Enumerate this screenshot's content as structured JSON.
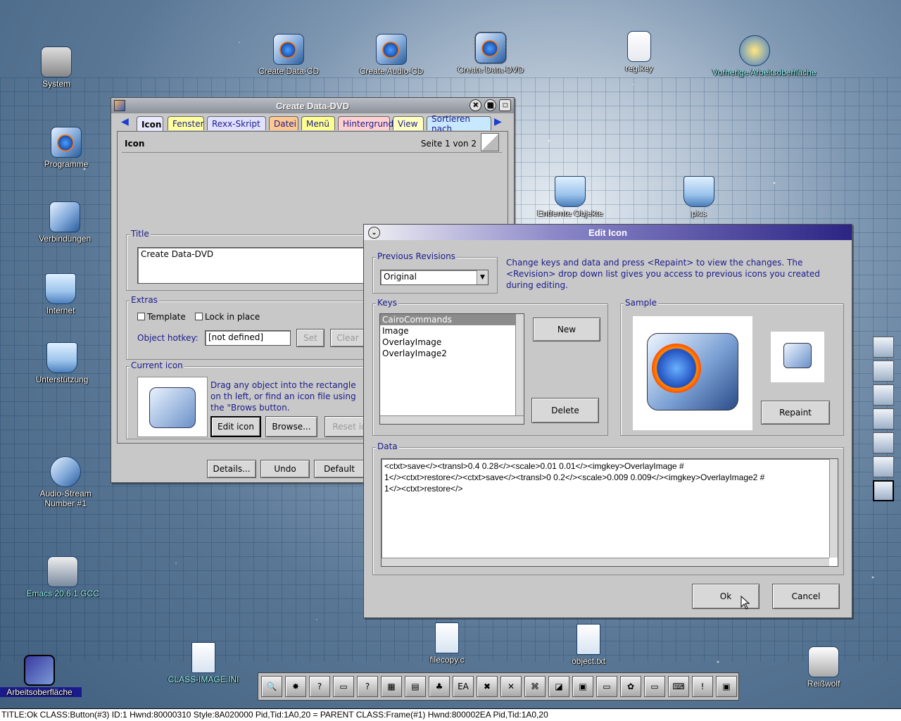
{
  "desktop": {
    "icons": [
      {
        "label": "System"
      },
      {
        "label": "Programme"
      },
      {
        "label": "Verbindungen"
      },
      {
        "label": "Internet"
      },
      {
        "label": "Unterstützung"
      },
      {
        "label": "Audio-Stream Number #1"
      },
      {
        "label": "Emacs 20.6.1 GCC"
      },
      {
        "label": "Create Data-CD"
      },
      {
        "label": "Create Audio-CD"
      },
      {
        "label": "Create Data-DVD"
      },
      {
        "label": "reg.key"
      },
      {
        "label": "Vorherige Arbeitsoberfläche"
      },
      {
        "label": "Entfernte Objekte"
      },
      {
        "label": "pics"
      },
      {
        "label": "filecopy.c"
      },
      {
        "label": "object.txt"
      },
      {
        "label": "CLASS-IMAGE.INI"
      },
      {
        "label": "Reißwolf"
      },
      {
        "label": "Arbeitsoberfläche"
      }
    ]
  },
  "settings_window": {
    "title": "Create Data-DVD",
    "tabs": [
      "Icon",
      "Fenster",
      "Rexx-Skript",
      "Datei",
      "Menü",
      "Hintergrund",
      "View",
      "Sortieren nach"
    ],
    "tab_colors": [
      "#e8e8ff",
      "#ffffa0",
      "#e0e0ff",
      "#ffc890",
      "#ffff90",
      "#ffd0d0",
      "#ffffc0",
      "#c8e8ff"
    ],
    "page_heading": "Icon",
    "page_indicator": "Seite 1 von 2",
    "title_group": "Title",
    "title_value": "Create Data-DVD",
    "extras_group": "Extras",
    "template_label": "Template",
    "lock_label": "Lock in place",
    "hotkey_label": "Object hotkey:",
    "hotkey_value": "[not defined]",
    "set_btn": "Set",
    "clear_btn": "Clear",
    "current_icon_group": "Current icon",
    "current_icon_help": "Drag any object into the rectangle on th left, or find an icon file using the \"Brows button.",
    "edit_icon_btn": "Edit icon",
    "browse_btn": "Browse...",
    "reset_btn": "Reset ic",
    "details_btn": "Details...",
    "undo_btn": "Undo",
    "default_btn": "Default"
  },
  "edit_icon_dialog": {
    "title": "Edit Icon",
    "prev_revisions_label": "Previous Revisions",
    "prev_revisions_value": "Original",
    "help_text": "Change keys and data and press <Repaint> to view the changes. The <Revision> drop down list gives you access to previous icons you created during editing.",
    "keys_label": "Keys",
    "keys": [
      "CairoCommands",
      "Image",
      "OverlayImage",
      "OverlayImage2"
    ],
    "new_btn": "New",
    "delete_btn": "Delete",
    "sample_label": "Sample",
    "repaint_btn": "Repaint",
    "data_label": "Data",
    "data_line1": "<ctxt>save</><transl>0.4 0.28</><scale>0.01 0.01</><imgkey>OverlayImage #",
    "data_line2": "1</><ctxt>restore</><ctxt>save</><transl>0 0.2</><scale>0.009 0.009</><imgkey>OverlayImage2 #",
    "data_line3": "1</><ctxt>restore</>",
    "ok_btn": "Ok",
    "cancel_btn": "Cancel"
  },
  "launchpad": {
    "ea_label": "EA"
  },
  "status_bar": "TITLE:Ok  CLASS:Button(#3)  ID:1  Hwnd:80000310  Style:8A020000  Pid,Tid:1A0,20 = PARENT CLASS:Frame(#1)  Hwnd:800002EA  Pid,Tid:1A0,20"
}
